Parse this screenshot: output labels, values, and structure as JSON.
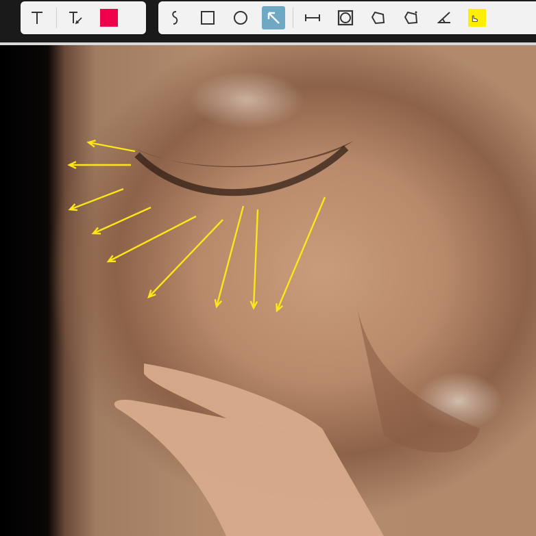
{
  "toolbar": {
    "text_tools": [
      {
        "name": "text-tool",
        "icon": "text-icon"
      },
      {
        "name": "text-edit-tool",
        "icon": "text-edit-icon"
      }
    ],
    "text_color": "#f0004a",
    "shape_tools": [
      {
        "name": "freehand-tool",
        "icon": "squiggle-icon"
      },
      {
        "name": "rectangle-tool",
        "icon": "square-icon"
      },
      {
        "name": "ellipse-tool",
        "icon": "circle-icon"
      },
      {
        "name": "arrow-tool",
        "icon": "arrow-icon",
        "active": true
      },
      {
        "name": "measure-line-tool",
        "icon": "measure-icon"
      },
      {
        "name": "framed-rectangle-tool",
        "icon": "framed-square-icon"
      },
      {
        "name": "polygon-tool",
        "icon": "polygon-icon"
      },
      {
        "name": "dashed-polygon-tool",
        "icon": "dashed-polygon-icon"
      },
      {
        "name": "angle-tool",
        "icon": "angle-icon"
      }
    ],
    "shape_color": "#ffee00",
    "active_accent": "#6ea8c4"
  },
  "annotation": {
    "arrow_color": "#ffe619",
    "arrow_count": 10
  }
}
